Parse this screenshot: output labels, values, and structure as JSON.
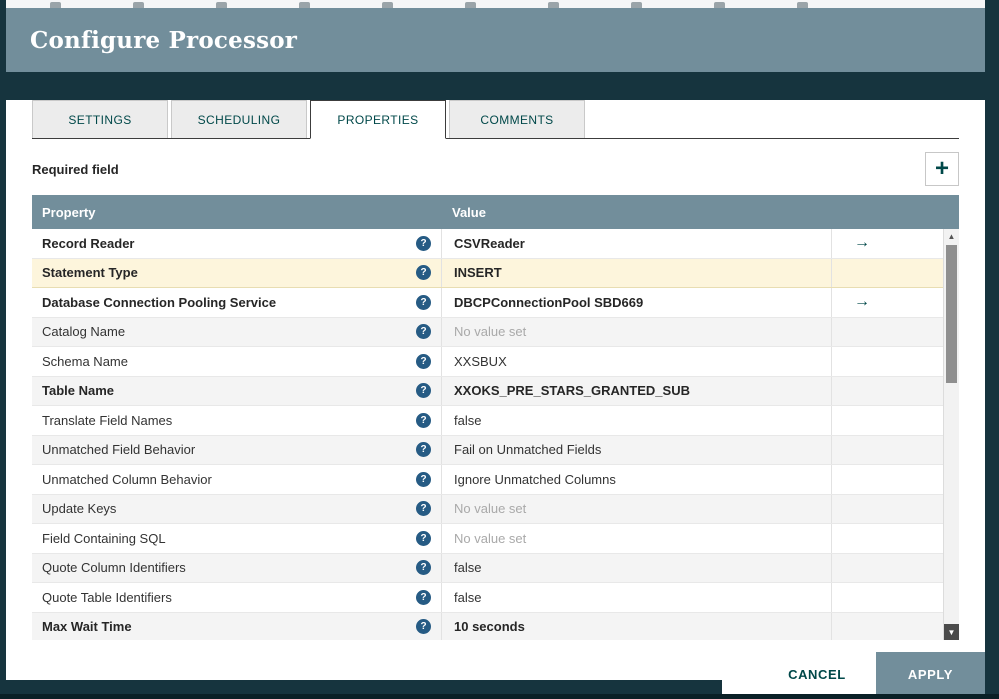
{
  "colors": {
    "frame": "#16343E",
    "header": "#728E9B",
    "accent": "#004849",
    "selected-row": "#FDF5DC",
    "alt-row": "#F4F4F4",
    "help": "#265B84"
  },
  "icons": {
    "add": "+",
    "help": "?",
    "goto": "→",
    "scroll_up": "▲",
    "scroll_down": "▼"
  },
  "dialog": {
    "title": "Configure Processor",
    "tabs": [
      {
        "label": "SETTINGS",
        "active": false
      },
      {
        "label": "SCHEDULING",
        "active": false
      },
      {
        "label": "PROPERTIES",
        "active": true
      },
      {
        "label": "COMMENTS",
        "active": false
      }
    ],
    "required_field_label": "Required field",
    "table": {
      "columns": [
        "Property",
        "Value"
      ],
      "rows": [
        {
          "property": "Record Reader",
          "value": "CSVReader",
          "required": true,
          "goto": true,
          "selected": false,
          "no_value": false
        },
        {
          "property": "Statement Type",
          "value": "INSERT",
          "required": true,
          "goto": false,
          "selected": true,
          "no_value": false
        },
        {
          "property": "Database Connection Pooling Service",
          "value": "DBCPConnectionPool SBD669",
          "required": true,
          "goto": true,
          "selected": false,
          "no_value": false
        },
        {
          "property": "Catalog Name",
          "value": "No value set",
          "required": false,
          "goto": false,
          "selected": false,
          "no_value": true
        },
        {
          "property": "Schema Name",
          "value": "XXSBUX",
          "required": false,
          "goto": false,
          "selected": false,
          "no_value": false
        },
        {
          "property": "Table Name",
          "value": "XXOKS_PRE_STARS_GRANTED_SUB",
          "required": true,
          "goto": false,
          "selected": false,
          "no_value": false
        },
        {
          "property": "Translate Field Names",
          "value": "false",
          "required": false,
          "goto": false,
          "selected": false,
          "no_value": false
        },
        {
          "property": "Unmatched Field Behavior",
          "value": "Fail on Unmatched Fields",
          "required": false,
          "goto": false,
          "selected": false,
          "no_value": false
        },
        {
          "property": "Unmatched Column Behavior",
          "value": "Ignore Unmatched Columns",
          "required": false,
          "goto": false,
          "selected": false,
          "no_value": false
        },
        {
          "property": "Update Keys",
          "value": "No value set",
          "required": false,
          "goto": false,
          "selected": false,
          "no_value": true
        },
        {
          "property": "Field Containing SQL",
          "value": "No value set",
          "required": false,
          "goto": false,
          "selected": false,
          "no_value": true
        },
        {
          "property": "Quote Column Identifiers",
          "value": "false",
          "required": false,
          "goto": false,
          "selected": false,
          "no_value": false
        },
        {
          "property": "Quote Table Identifiers",
          "value": "false",
          "required": false,
          "goto": false,
          "selected": false,
          "no_value": false
        },
        {
          "property": "Max Wait Time",
          "value": "10 seconds",
          "required": true,
          "goto": false,
          "selected": false,
          "no_value": false
        }
      ]
    },
    "buttons": {
      "cancel": "CANCEL",
      "apply": "APPLY"
    }
  }
}
